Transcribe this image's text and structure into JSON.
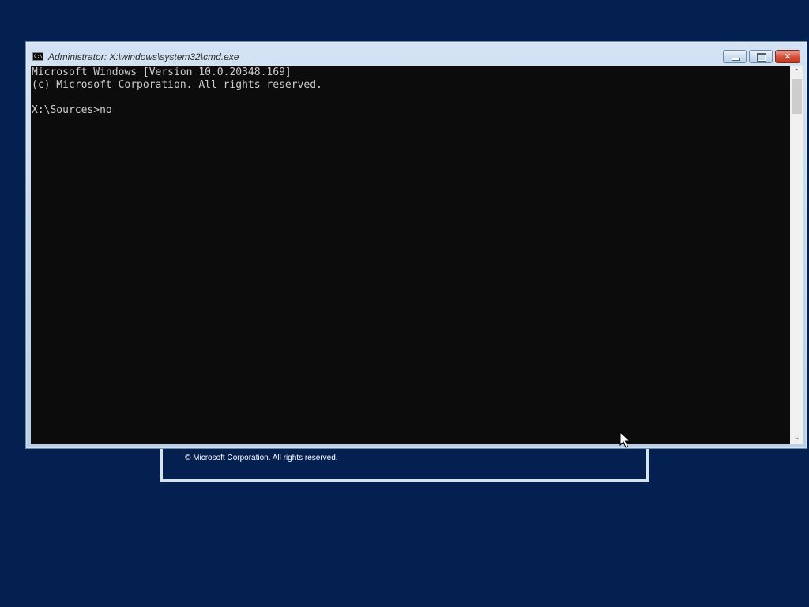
{
  "setup_window": {
    "copyright": "© Microsoft Corporation. All rights reserved."
  },
  "console_window": {
    "title": "Administrator: X:\\windows\\system32\\cmd.exe",
    "icon": "cmd-icon",
    "icon_text": "C:\\",
    "buttons": {
      "minimize": "minimize-icon",
      "maximize": "maximize-icon",
      "close_glyph": "✕"
    },
    "lines": [
      "Microsoft Windows [Version 10.0.20348.169]",
      "(c) Microsoft Corporation. All rights reserved.",
      "",
      "X:\\Sources>no"
    ],
    "colors": {
      "background": "#0c0c0c",
      "text": "#cccccc"
    }
  },
  "scrollbar": {
    "up_arrow": "⌃",
    "down_arrow": "⌄"
  },
  "desktop": {
    "background": "#032050"
  }
}
